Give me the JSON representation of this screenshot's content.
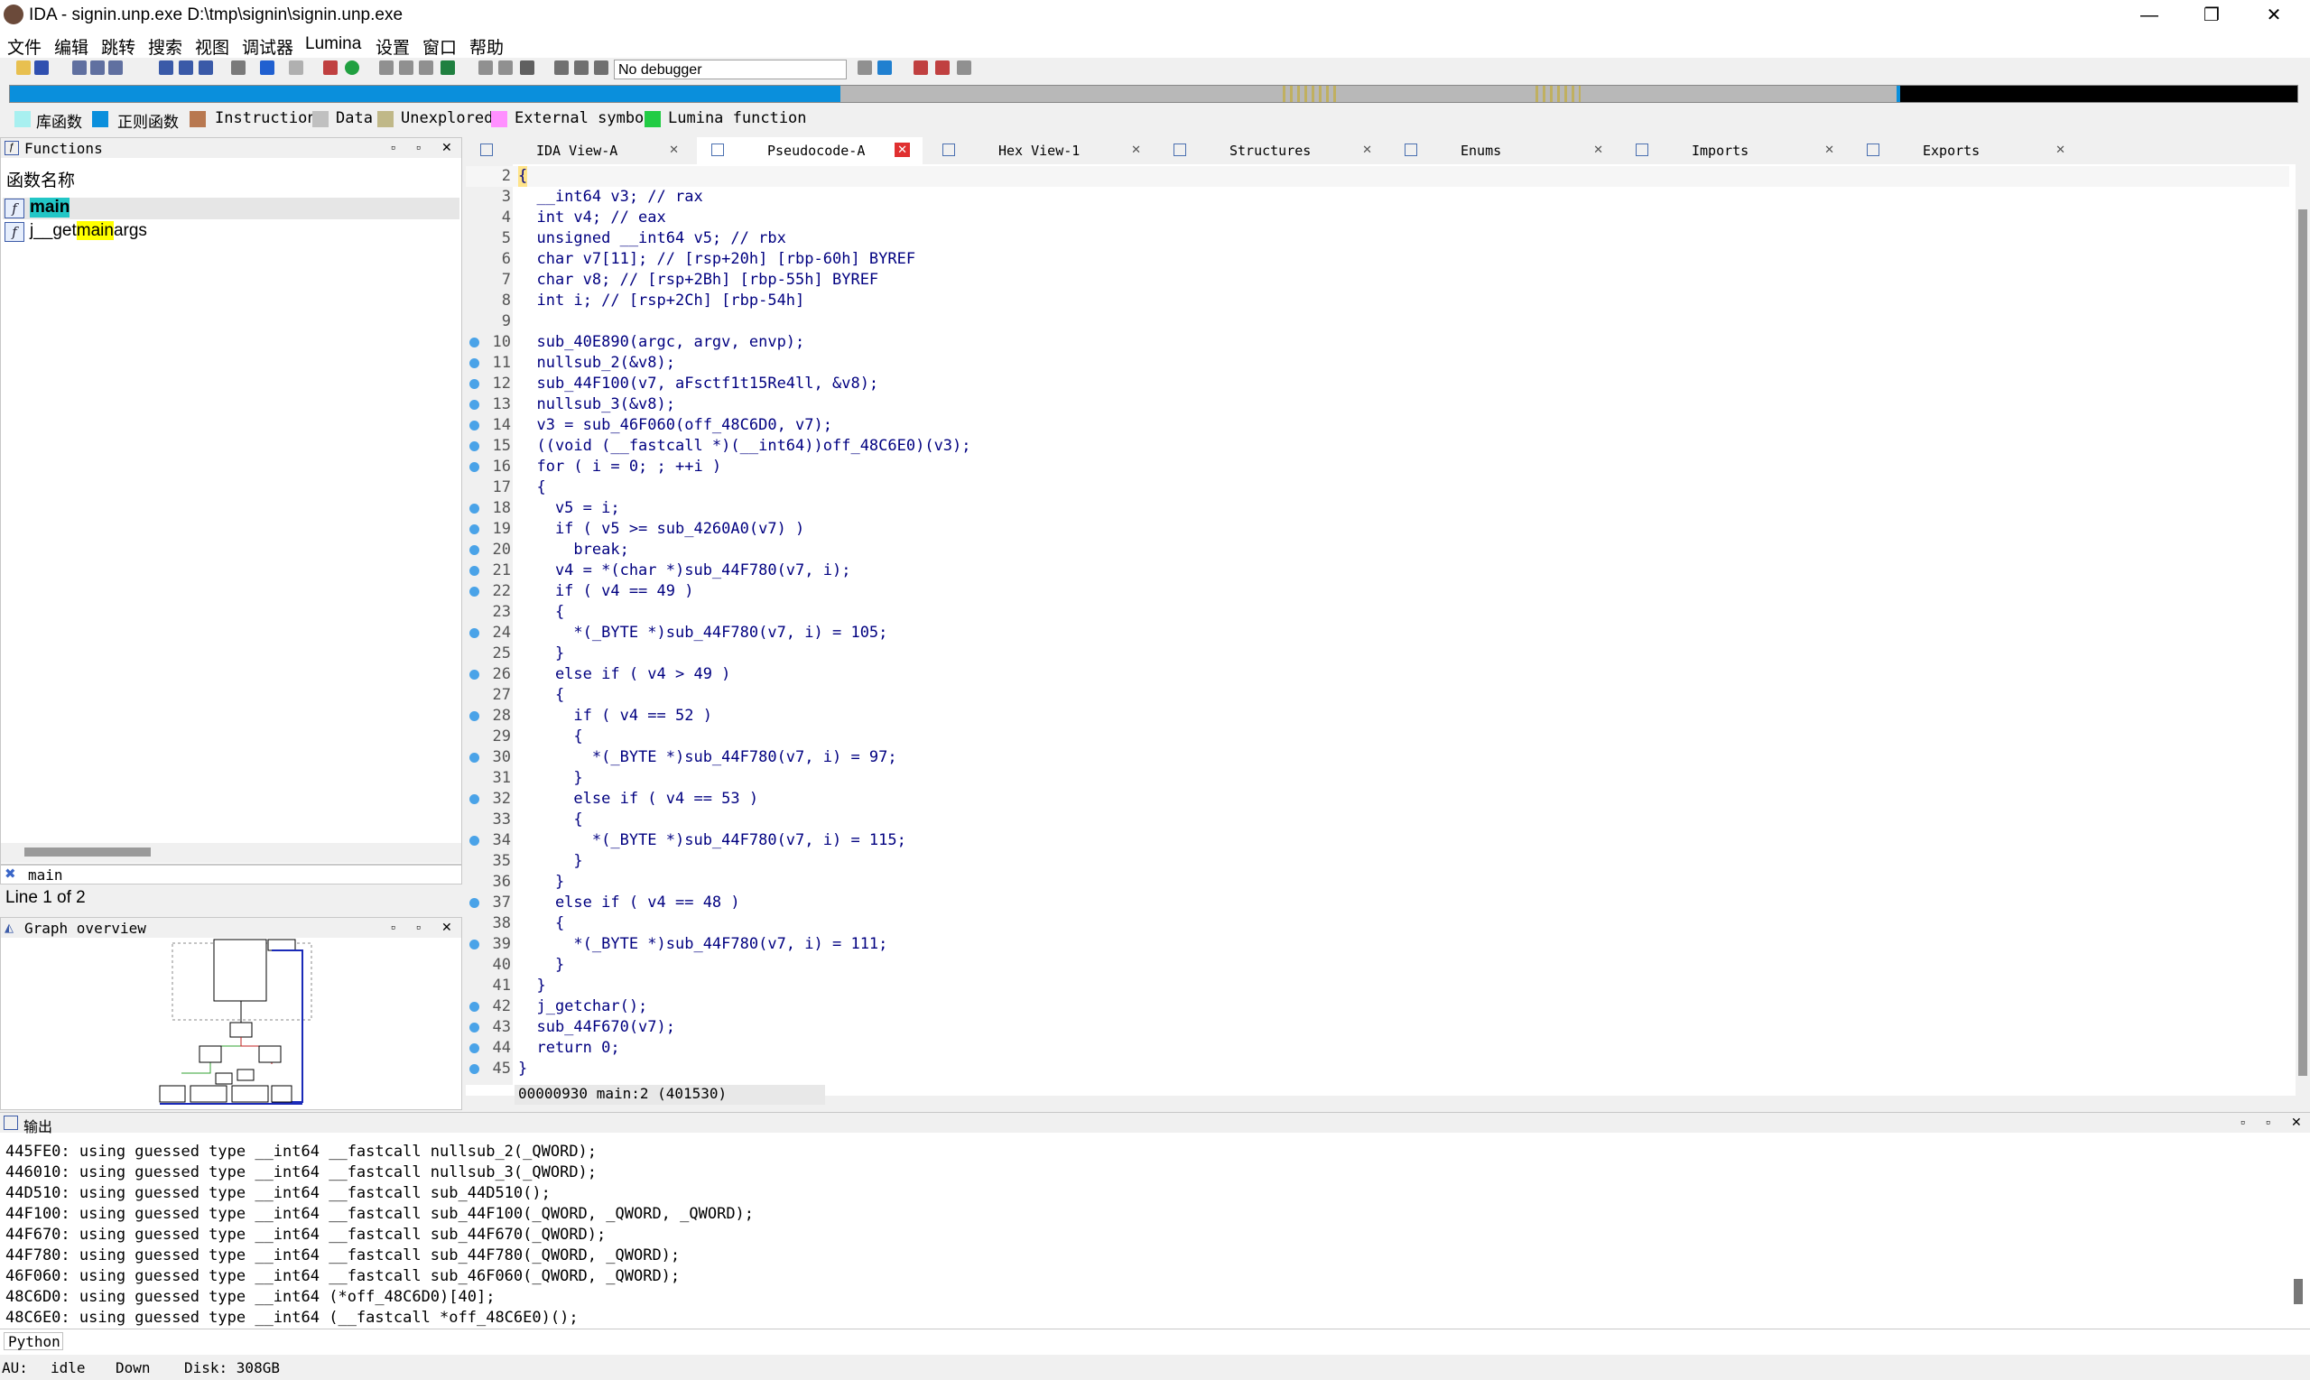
{
  "window": {
    "title": "IDA - signin.unp.exe D:\\tmp\\signin\\signin.unp.exe",
    "minimize": "—",
    "maximize": "❐",
    "close": "✕"
  },
  "menu": [
    "文件",
    "编辑",
    "跳转",
    "搜索",
    "视图",
    "调试器",
    "Lumina",
    "设置",
    "窗口",
    "帮助"
  ],
  "toolbar": {
    "debugger": "No debugger"
  },
  "legend": [
    {
      "label": "库函数",
      "color": "#a8f0f0"
    },
    {
      "label": "正则函数",
      "color": "#0a8fdc"
    },
    {
      "label": "Instruction",
      "color": "#b87850"
    },
    {
      "label": "Data",
      "color": "#c0c0c0"
    },
    {
      "label": "Unexplored",
      "color": "#c0b888"
    },
    {
      "label": "External symbol",
      "color": "#ff90ff"
    },
    {
      "label": "Lumina function",
      "color": "#22cc44"
    }
  ],
  "functions": {
    "title": "Functions",
    "column": "函数名称",
    "items": [
      {
        "name": "main"
      },
      {
        "name_prefix": "j__get",
        "name_match": "main",
        "name_suffix": "args"
      }
    ],
    "filter": "main",
    "line_info": "Line 1 of 2"
  },
  "graph_overview": {
    "title": "Graph overview"
  },
  "tabs": [
    {
      "label": "IDA View-A",
      "active": false
    },
    {
      "label": "Pseudocode-A",
      "active": true
    },
    {
      "label": "Hex View-1",
      "active": false
    },
    {
      "label": "Structures",
      "active": false
    },
    {
      "label": "Enums",
      "active": false
    },
    {
      "label": "Imports",
      "active": false
    },
    {
      "label": "Exports",
      "active": false
    }
  ],
  "code": [
    {
      "n": "2",
      "bp": false,
      "t": "{"
    },
    {
      "n": "3",
      "bp": false,
      "t": "  __int64 v3; // rax"
    },
    {
      "n": "4",
      "bp": false,
      "t": "  int v4; // eax"
    },
    {
      "n": "5",
      "bp": false,
      "t": "  unsigned __int64 v5; // rbx"
    },
    {
      "n": "6",
      "bp": false,
      "t": "  char v7[11]; // [rsp+20h] [rbp-60h] BYREF"
    },
    {
      "n": "7",
      "bp": false,
      "t": "  char v8; // [rsp+2Bh] [rbp-55h] BYREF"
    },
    {
      "n": "8",
      "bp": false,
      "t": "  int i; // [rsp+2Ch] [rbp-54h]"
    },
    {
      "n": "9",
      "bp": false,
      "t": ""
    },
    {
      "n": "10",
      "bp": true,
      "t": "  sub_40E890(argc, argv, envp);"
    },
    {
      "n": "11",
      "bp": true,
      "t": "  nullsub_2(&v8);"
    },
    {
      "n": "12",
      "bp": true,
      "t": "  sub_44F100(v7, aFsctf1t15Re4ll, &v8);"
    },
    {
      "n": "13",
      "bp": true,
      "t": "  nullsub_3(&v8);"
    },
    {
      "n": "14",
      "bp": true,
      "t": "  v3 = sub_46F060(off_48C6D0, v7);"
    },
    {
      "n": "15",
      "bp": true,
      "t": "  ((void (__fastcall *)(__int64))off_48C6E0)(v3);"
    },
    {
      "n": "16",
      "bp": true,
      "t": "  for ( i = 0; ; ++i )"
    },
    {
      "n": "17",
      "bp": false,
      "t": "  {"
    },
    {
      "n": "18",
      "bp": true,
      "t": "    v5 = i;"
    },
    {
      "n": "19",
      "bp": true,
      "t": "    if ( v5 >= sub_4260A0(v7) )"
    },
    {
      "n": "20",
      "bp": true,
      "t": "      break;"
    },
    {
      "n": "21",
      "bp": true,
      "t": "    v4 = *(char *)sub_44F780(v7, i);"
    },
    {
      "n": "22",
      "bp": true,
      "t": "    if ( v4 == 49 )"
    },
    {
      "n": "23",
      "bp": false,
      "t": "    {"
    },
    {
      "n": "24",
      "bp": true,
      "t": "      *(_BYTE *)sub_44F780(v7, i) = 105;"
    },
    {
      "n": "25",
      "bp": false,
      "t": "    }"
    },
    {
      "n": "26",
      "bp": true,
      "t": "    else if ( v4 > 49 )"
    },
    {
      "n": "27",
      "bp": false,
      "t": "    {"
    },
    {
      "n": "28",
      "bp": true,
      "t": "      if ( v4 == 52 )"
    },
    {
      "n": "29",
      "bp": false,
      "t": "      {"
    },
    {
      "n": "30",
      "bp": true,
      "t": "        *(_BYTE *)sub_44F780(v7, i) = 97;"
    },
    {
      "n": "31",
      "bp": false,
      "t": "      }"
    },
    {
      "n": "32",
      "bp": true,
      "t": "      else if ( v4 == 53 )"
    },
    {
      "n": "33",
      "bp": false,
      "t": "      {"
    },
    {
      "n": "34",
      "bp": true,
      "t": "        *(_BYTE *)sub_44F780(v7, i) = 115;"
    },
    {
      "n": "35",
      "bp": false,
      "t": "      }"
    },
    {
      "n": "36",
      "bp": false,
      "t": "    }"
    },
    {
      "n": "37",
      "bp": true,
      "t": "    else if ( v4 == 48 )"
    },
    {
      "n": "38",
      "bp": false,
      "t": "    {"
    },
    {
      "n": "39",
      "bp": true,
      "t": "      *(_BYTE *)sub_44F780(v7, i) = 111;"
    },
    {
      "n": "40",
      "bp": false,
      "t": "    }"
    },
    {
      "n": "41",
      "bp": false,
      "t": "  }"
    },
    {
      "n": "42",
      "bp": true,
      "t": "  j_getchar();"
    },
    {
      "n": "43",
      "bp": true,
      "t": "  sub_44F670(v7);"
    },
    {
      "n": "44",
      "bp": true,
      "t": "  return 0;"
    },
    {
      "n": "45",
      "bp": true,
      "t": "}"
    }
  ],
  "code_status": "00000930 main:2 (401530)",
  "output": {
    "title": "输出",
    "lines": [
      "445FE0: using guessed type __int64 __fastcall nullsub_2(_QWORD);",
      "446010: using guessed type __int64 __fastcall nullsub_3(_QWORD);",
      "44D510: using guessed type __int64 __fastcall sub_44D510();",
      "44F100: using guessed type __int64 __fastcall sub_44F100(_QWORD, _QWORD, _QWORD);",
      "44F670: using guessed type __int64 __fastcall sub_44F670(_QWORD);",
      "44F780: using guessed type __int64 __fastcall sub_44F780(_QWORD, _QWORD);",
      "46F060: using guessed type __int64 __fastcall sub_46F060(_QWORD, _QWORD);",
      "48C6D0: using guessed type __int64 (*off_48C6D0)[40];",
      "48C6E0: using guessed type __int64 (__fastcall *off_48C6E0)();"
    ]
  },
  "python": {
    "label": "Python"
  },
  "status": {
    "au": "AU:",
    "state": "idle",
    "direction": "Down",
    "disk": "Disk: 308GB"
  }
}
